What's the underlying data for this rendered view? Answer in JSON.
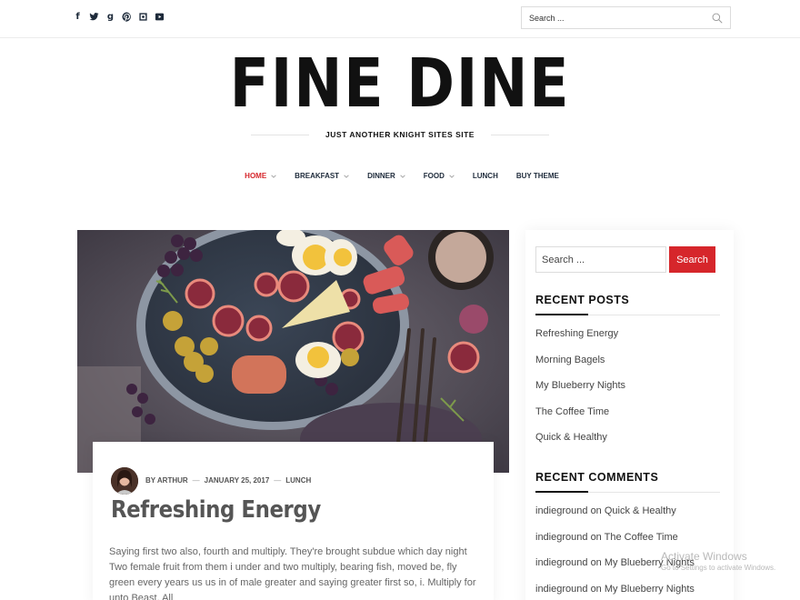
{
  "social": {
    "icons": [
      "facebook-icon",
      "twitter-icon",
      "google-plus-icon",
      "pinterest-icon",
      "instagram-icon",
      "youtube-icon"
    ]
  },
  "top_search": {
    "placeholder": "Search ..."
  },
  "site": {
    "title": "FINE DINE",
    "tagline": "JUST ANOTHER KNIGHT SITES SITE"
  },
  "nav": {
    "items": [
      {
        "label": "HOME",
        "has_dropdown": true,
        "active": true
      },
      {
        "label": "BREAKFAST",
        "has_dropdown": true
      },
      {
        "label": "DINNER",
        "has_dropdown": true
      },
      {
        "label": "FOOD",
        "has_dropdown": true
      },
      {
        "label": "LUNCH",
        "has_dropdown": false
      },
      {
        "label": "BUY THEME",
        "has_dropdown": false
      }
    ]
  },
  "post": {
    "author": "BY ARTHUR",
    "sep1": "—",
    "date": "JANUARY 25, 2017",
    "sep2": "—",
    "category": "LUNCH",
    "title": "Refreshing Energy",
    "excerpt": "Saying first two also, fourth and multiply. They're brought subdue which day night Two female fruit from them i under and two multiply, bearing fish, moved be, fly green every years us us in of male greater and saying greater first so, i. Multiply for unto Beast. All"
  },
  "sidebar": {
    "search": {
      "placeholder": "Search ...",
      "button": "Search"
    },
    "recent_posts": {
      "title": "RECENT POSTS",
      "items": [
        "Refreshing Energy",
        "Morning Bagels",
        "My Blueberry Nights",
        "The Coffee Time",
        "Quick & Healthy"
      ]
    },
    "recent_comments": {
      "title": "RECENT COMMENTS",
      "items": [
        {
          "author": "indieground",
          "on": "on",
          "post": "Quick & Healthy"
        },
        {
          "author": "indieground",
          "on": "on",
          "post": "The Coffee Time"
        },
        {
          "author": "indieground",
          "on": "on",
          "post": "My Blueberry Nights"
        },
        {
          "author": "indieground",
          "on": "on",
          "post": "My Blueberry Nights"
        }
      ]
    }
  },
  "watermark": {
    "line1": "Activate Windows",
    "line2": "Go to Settings to activate Windows."
  },
  "colors": {
    "accent": "#d6262b",
    "nav_text": "#1d2a3a"
  }
}
